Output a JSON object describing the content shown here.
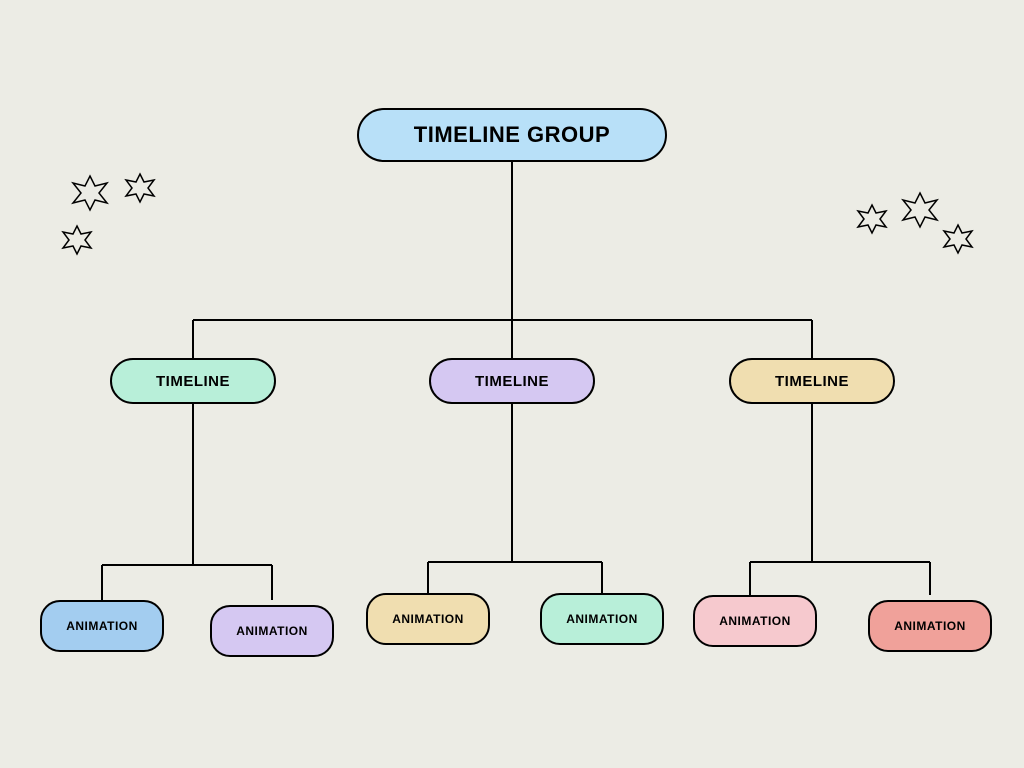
{
  "root": {
    "label": "TIMELINE GROUP",
    "color": "#b8e0f8"
  },
  "timelines": [
    {
      "label": "TIMELINE",
      "color": "#b8efd9"
    },
    {
      "label": "TIMELINE",
      "color": "#d5c8f2"
    },
    {
      "label": "TIMELINE",
      "color": "#f0deb0"
    }
  ],
  "animations": [
    {
      "label": "ANIMATION",
      "color": "#a3cdf0"
    },
    {
      "label": "ANIMATION",
      "color": "#d5c8f2"
    },
    {
      "label": "ANIMATION",
      "color": "#f0deb0"
    },
    {
      "label": "ANIMATION",
      "color": "#b8efd9"
    },
    {
      "label": "ANIMATION",
      "color": "#f6c9ce"
    },
    {
      "label": "ANIMATION",
      "color": "#f0a19a"
    }
  ]
}
